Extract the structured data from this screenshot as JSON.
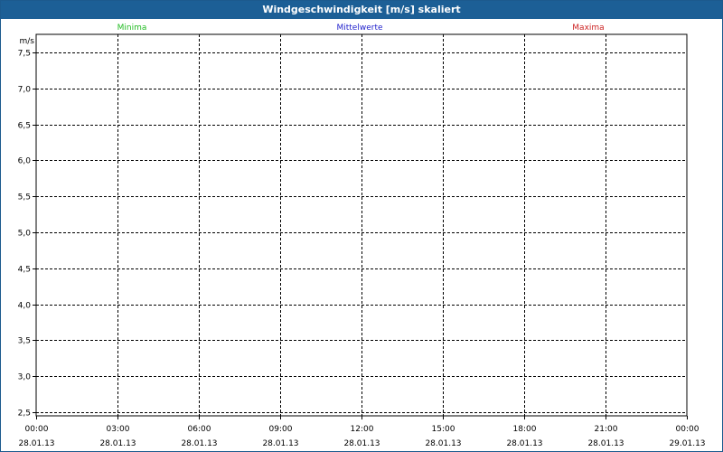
{
  "chart_data": {
    "type": "line",
    "title": "Windgeschwindigkeit [m/s] skaliert",
    "ylabel": "m/s",
    "ylim": [
      2.45,
      7.75
    ],
    "y_ticks": [
      "2,5",
      "3,0",
      "3,5",
      "4,0",
      "4,5",
      "5,0",
      "5,5",
      "6,0",
      "6,5",
      "7,0",
      "7,5"
    ],
    "y_tick_values": [
      2.5,
      3.0,
      3.5,
      4.0,
      4.5,
      5.0,
      5.5,
      6.0,
      6.5,
      7.0,
      7.5
    ],
    "x_ticks": [
      {
        "time": "00:00",
        "date": "28.01.13"
      },
      {
        "time": "03:00",
        "date": "28.01.13"
      },
      {
        "time": "06:00",
        "date": "28.01.13"
      },
      {
        "time": "09:00",
        "date": "28.01.13"
      },
      {
        "time": "12:00",
        "date": "28.01.13"
      },
      {
        "time": "15:00",
        "date": "28.01.13"
      },
      {
        "time": "18:00",
        "date": "28.01.13"
      },
      {
        "time": "21:00",
        "date": "28.01.13"
      },
      {
        "time": "00:00",
        "date": "29.01.13"
      }
    ],
    "series": [
      {
        "name": "Minima",
        "color": "#22bb22",
        "values": []
      },
      {
        "name": "Mittelwerte",
        "color": "#2222cc",
        "values": []
      },
      {
        "name": "Maxima",
        "color": "#cc2222",
        "values": []
      }
    ],
    "grid": true
  }
}
